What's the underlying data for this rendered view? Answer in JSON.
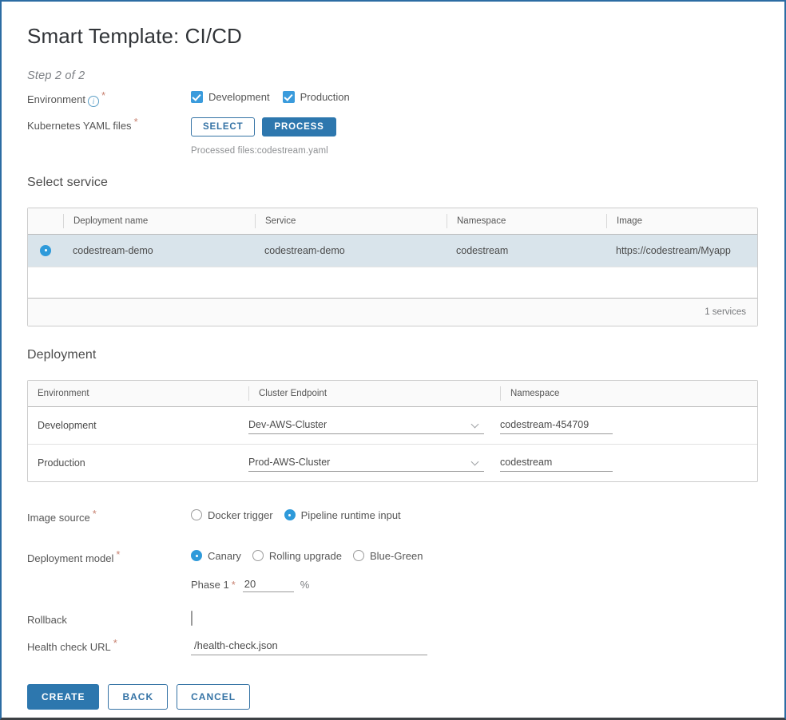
{
  "title": "Smart Template: CI/CD",
  "step": "Step 2 of 2",
  "environment": {
    "label": "Environment",
    "info_icon": "info-circle-icon",
    "required_marker": "*",
    "options": [
      {
        "label": "Development",
        "checked": true
      },
      {
        "label": "Production",
        "checked": true
      }
    ]
  },
  "yaml": {
    "label": "Kubernetes YAML files",
    "required_marker": "*",
    "select_button": "SELECT",
    "process_button": "PROCESS",
    "processed_note": "Processed files:codestream.yaml"
  },
  "select_service": {
    "heading": "Select service",
    "columns": [
      "",
      "Deployment name",
      "Service",
      "Namespace",
      "Image"
    ],
    "rows": [
      {
        "selected": true,
        "deployment_name": "codestream-demo",
        "service": "codestream-demo",
        "namespace": "codestream",
        "image": "https://codestream/Myapp"
      }
    ],
    "footer": "1 services"
  },
  "deployment": {
    "heading": "Deployment",
    "columns": [
      "Environment",
      "Cluster Endpoint",
      "Namespace"
    ],
    "rows": [
      {
        "environment": "Development",
        "cluster_endpoint": "Dev-AWS-Cluster",
        "namespace": "codestream-454709"
      },
      {
        "environment": "Production",
        "cluster_endpoint": "Prod-AWS-Cluster",
        "namespace": "codestream"
      }
    ]
  },
  "image_source": {
    "label": "Image source",
    "required_marker": "*",
    "options": [
      {
        "label": "Docker trigger",
        "selected": false
      },
      {
        "label": "Pipeline runtime input",
        "selected": true
      }
    ]
  },
  "deployment_model": {
    "label": "Deployment model",
    "required_marker": "*",
    "options": [
      {
        "label": "Canary",
        "selected": true
      },
      {
        "label": "Rolling upgrade",
        "selected": false
      },
      {
        "label": "Blue-Green",
        "selected": false
      }
    ],
    "phase_label": "Phase 1",
    "phase_required_marker": "*",
    "phase_value": "20",
    "phase_unit": "%"
  },
  "rollback": {
    "label": "Rollback",
    "checked": false
  },
  "health_check": {
    "label": "Health check URL",
    "required_marker": "*",
    "value": "/health-check.json"
  },
  "footer": {
    "create": "CREATE",
    "back": "BACK",
    "cancel": "CANCEL"
  },
  "colors": {
    "accent": "#2d77ae",
    "checkbox": "#3a9bdc",
    "radio": "#2e9ada",
    "required": "#c78170",
    "selected_row": "#d9e4eb",
    "frame": "#2c6ca3"
  }
}
